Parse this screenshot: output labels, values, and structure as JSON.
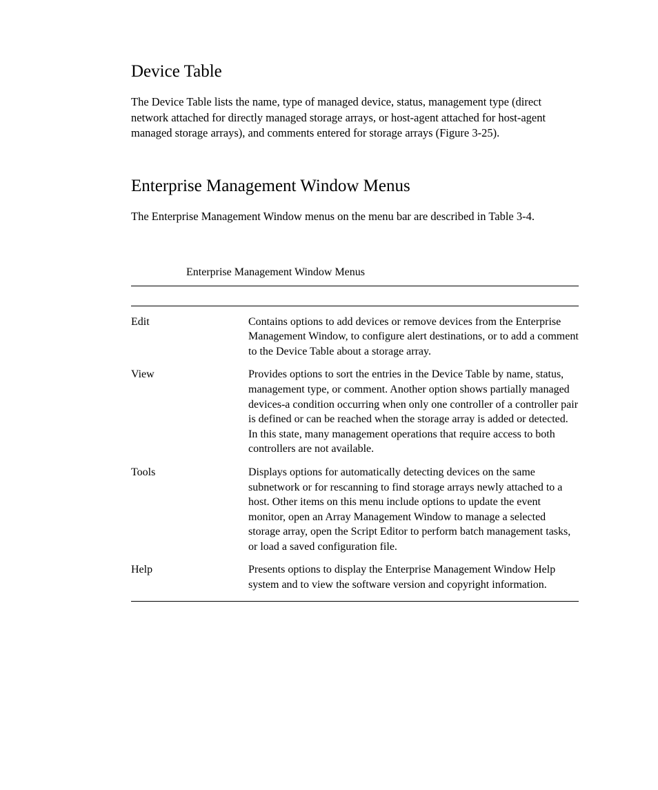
{
  "section1": {
    "heading": "Device Table",
    "paragraph": "The Device Table lists the name, type of managed device, status, management type (direct network attached for directly managed storage arrays, or host-agent attached for host-agent managed storage arrays), and comments entered for storage arrays (Figure 3-25)."
  },
  "section2": {
    "heading": "Enterprise Management Window Menus",
    "paragraph": "The Enterprise Management Window menus on the menu bar are described in Table 3-4."
  },
  "table": {
    "caption": "Enterprise Management Window Menus",
    "rows": [
      {
        "menu": "Edit",
        "description": "Contains options to add devices or remove devices from the Enterprise Management Window, to configure alert destinations, or to add a comment to the Device Table about a storage array."
      },
      {
        "menu": "View",
        "description": "Provides options to sort the entries in the Device Table by name, status, management type, or comment. Another option shows partially managed devices-a condition occurring when only one controller of a controller pair is defined or can be reached when the storage array is added or detected. In this state, many management operations that require access to both controllers are not available."
      },
      {
        "menu": "Tools",
        "description": "Displays options for automatically detecting devices on the same subnetwork or for rescanning to find storage arrays newly attached to a host. Other items on this menu include options to update the event monitor, open an Array Management Window to manage a selected storage array, open the Script Editor to perform batch management tasks, or load a saved configuration file."
      },
      {
        "menu": "Help",
        "description": "Presents options to display the Enterprise Management Window Help system and to view the software version and copyright information."
      }
    ]
  }
}
